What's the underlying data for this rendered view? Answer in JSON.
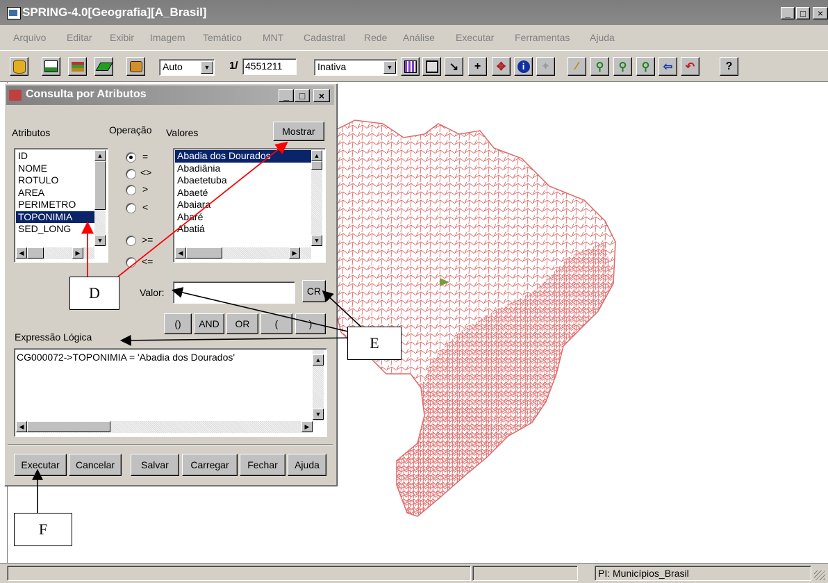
{
  "window": {
    "title": "SPRING-4.0[Geografia][A_Brasil]",
    "controls": [
      "_",
      "□",
      "×"
    ]
  },
  "menu": [
    {
      "label": "Arquivo"
    },
    {
      "label": "Editar"
    },
    {
      "label": "Exibir"
    },
    {
      "label": "Imagem"
    },
    {
      "label": "Temático"
    },
    {
      "label": "MNT"
    },
    {
      "label": "Cadastral"
    },
    {
      "label": "Rede"
    },
    {
      "label": "Análise"
    },
    {
      "label": "Executar"
    },
    {
      "label": "Ferramentas"
    },
    {
      "label": "Ajuda"
    }
  ],
  "toolbar": {
    "scale_mode": "Auto",
    "scale_prefix": "1/",
    "scale_value": "4551211",
    "state_value": "Inativa",
    "help_glyph": "?"
  },
  "dialog": {
    "title": "Consulta por Atributos",
    "attributes_label": "Atributos",
    "operation_label": "Operação",
    "values_label": "Valores",
    "show_button": "Mostrar",
    "attributes": [
      "ID",
      "NOME",
      "ROTULO",
      "AREA",
      "PERIMETRO",
      "TOPONIMIA",
      "SED_LONG"
    ],
    "attributes_selected": "TOPONIMIA",
    "operations": [
      {
        "label": "=",
        "checked": true
      },
      {
        "label": "<>",
        "checked": false
      },
      {
        "label": ">",
        "checked": false
      },
      {
        "label": "<",
        "checked": false
      },
      {
        "label": ">=",
        "checked": false
      },
      {
        "label": "<=",
        "checked": false
      }
    ],
    "values": [
      "Abadia dos Dourados",
      "Abadiânia",
      "Abaetetuba",
      "Abaeté",
      "Abaiara",
      "Abaré",
      "Abatiá"
    ],
    "values_selected": "Abadia dos Dourados",
    "valor_label": "Valor:",
    "valor_value": "",
    "cr_button": "CR",
    "logic_buttons": [
      "()",
      "AND",
      "OR",
      "(",
      ")"
    ],
    "expression_label": "Expressão Lógica",
    "expression_value": "CG000072->TOPONIMIA = 'Abadia dos Dourados'",
    "footer_buttons": [
      "Executar",
      "Cancelar",
      "Salvar",
      "Carregar",
      "Fechar",
      "Ajuda"
    ]
  },
  "callouts": {
    "d": "D",
    "e": "E",
    "f": "F"
  },
  "status": {
    "plan": "PI: Municípios_Brasil"
  },
  "colors": {
    "map_lines": "#e06a6a",
    "title_bar": "#808080",
    "selection": "#0a246a",
    "arrow": "#ff0000"
  }
}
